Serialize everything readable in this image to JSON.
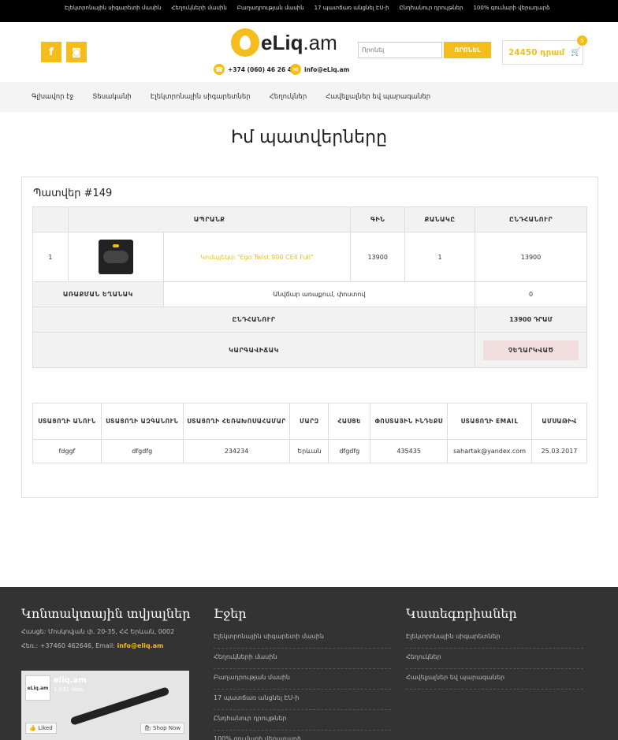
{
  "topbar": {
    "links": [
      "Էլեկտրոնային սիգարետի մասին",
      "Հեղուկների մասին",
      "Բաղադրության մասին",
      "17 պատճառ անցնել ԷՍ-ի",
      "Ընդհանուր դրույթներ",
      "100% գումարի վերադարձ"
    ]
  },
  "header": {
    "facebook_glyph": "f",
    "instagram_glyph": "◙",
    "logo_brand": "eLiq",
    "logo_tld": ".am",
    "phone": "+374 (060) 46 26 46",
    "email": "info@eLiq.am",
    "search_placeholder": "Որոնել",
    "search_button": "ՈՐՈՆԵԼ",
    "cart_amount": "24450 դրամ",
    "cart_count": "5"
  },
  "nav": {
    "items": [
      "Գլխավոր էջ",
      "Տեսականի",
      "Էլեկտրոնային սիգարետներ",
      "Հեղուկներ",
      "Հավելյալներ եվ պարագաներ"
    ]
  },
  "page": {
    "title": "Իմ պատվերները"
  },
  "order": {
    "heading": "Պատվեր #149",
    "columns": {
      "product": "ԱՊՐԱՆՔ",
      "price": "ԳԻՆ",
      "quantity": "ՔԱՆԱԿԸ",
      "total": "ԸՆԴՀԱՆՈՒՐ"
    },
    "items": [
      {
        "index": "1",
        "name": "Կոմպլեկտ \"Ego Twist 900 CE4 Full\"",
        "price": "13900",
        "quantity": "1",
        "total": "13900"
      }
    ],
    "delivery_label": "ԱՌԱՔՄԱՆ ԵՂԱՆԱԿ",
    "delivery_method": "Անվճար առաքում, փոստով",
    "delivery_cost": "0",
    "grand_total_label": "ԸՆԴՀԱՆՈՒՐ",
    "grand_total": "13900 ԴՐԱՄ",
    "status_label": "ԿԱՐԳԱՎԻՃԱԿ",
    "status": "ՉԵՂԱՐԿՎԱԾ"
  },
  "customer": {
    "headers": [
      "ՍՏԱՑՈՂԻ ԱՆՈՒՆ",
      "ՍՏԱՑՈՂԻ ԱԶԳԱՆՈՒՆ",
      "ՍՏԱՑՈՂԻ ՀԵՌԱԽՈՍԱՀԱՄԱՐ",
      "ՄԱՐԶ",
      "ՀԱՍՑԵ",
      "ՓՈՍՏԱՅԻՆ ԻՆԴԵՔՍ",
      "ՍՏԱՑՈՂԻ EMAIL",
      "ԱՄՍԱԹԻՎ"
    ],
    "values": [
      "fdggf",
      "dfgdfg",
      "234234",
      "Երևան",
      "dfgdfg",
      "435435",
      "sahartak@yandex.com",
      "25.03.2017"
    ]
  },
  "footer": {
    "contacts_title": "Կոնտակտային տվյալներ",
    "address": "Հասցե: Մոսկովյան փ. 20-35, ՀՀ Երևան, 0002",
    "phone_email_prefix": "Հեռ.: +37460 462646, Email: ",
    "email": "info@eliq.am",
    "pages_title": "Էջեր",
    "pages": [
      "Էլեկտրոնային սիգարետի մասին",
      "Հեղուկների մասին",
      "Բաղադրության մասին",
      "17 պատճառ անցնել ԷՍ-ի",
      "Ընդհանուր դրույթներ",
      "100% գումարի վերադարձ"
    ],
    "categories_title": "Կատեգորիաներ",
    "categories": [
      "Էլեկտրոնային սիգարետներ",
      "Հեղուկներ",
      "Հավելյալներ եվ պարագաներ"
    ],
    "fb": {
      "page_name": "eliq.am",
      "likes": "1,031 likes",
      "logo_text": "eLiq.am",
      "like_button": "Liked",
      "shop_button": "Shop Now"
    }
  },
  "colors": {
    "accent": "#f5bd1b",
    "status_cancelled_bg": "#f2dede",
    "footer_bg": "#333333"
  }
}
